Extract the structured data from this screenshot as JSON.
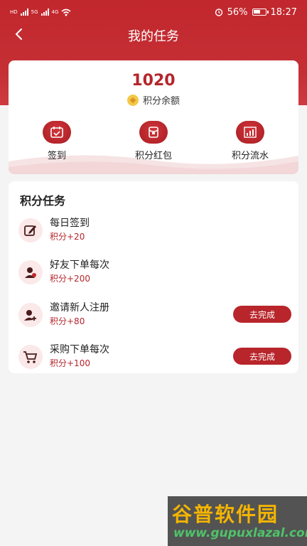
{
  "status_bar": {
    "sim_labels": [
      "HD",
      "5G",
      "4G"
    ],
    "battery_percent": "56%",
    "time": "18:27"
  },
  "nav": {
    "title": "我的任务"
  },
  "points": {
    "value": "1020",
    "label": "积分余额"
  },
  "actions": [
    {
      "label": "签到",
      "icon": "calendar-check-icon"
    },
    {
      "label": "积分红包",
      "icon": "red-envelope-icon"
    },
    {
      "label": "积分流水",
      "icon": "bar-chart-icon"
    }
  ],
  "tasks": {
    "title": "积分任务",
    "items": [
      {
        "name": "每日签到",
        "points": "积分+20",
        "icon": "edit-icon",
        "button": ""
      },
      {
        "name": "好友下单每次",
        "points": "积分+200",
        "icon": "user-group-icon",
        "button": ""
      },
      {
        "name": "邀请新人注册",
        "points": "积分+80",
        "icon": "user-add-icon",
        "button": "去完成"
      },
      {
        "name": "采购下单每次",
        "points": "积分+100",
        "icon": "cart-icon",
        "button": "去完成"
      }
    ]
  },
  "watermark": {
    "brand": "谷普软件园",
    "url": "www.gupuxlazal.com"
  },
  "colors": {
    "brand": "#c1272d",
    "accent_text": "#b5252b",
    "page_bg": "#f4f4f4"
  }
}
